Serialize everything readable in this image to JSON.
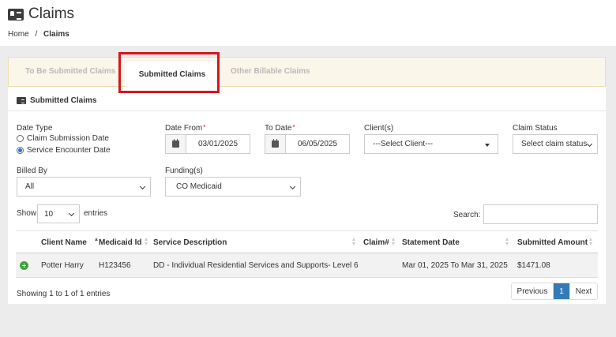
{
  "header": {
    "title": "Claims",
    "breadcrumb": {
      "home": "Home",
      "separator": "/",
      "current": "Claims"
    }
  },
  "tabs": [
    {
      "label": "To Be Submitted Claims",
      "active": false
    },
    {
      "label": "Submitted Claims",
      "active": true
    },
    {
      "label": "Other Billable Claims",
      "active": false
    }
  ],
  "section": {
    "title": "Submitted Claims"
  },
  "filters": {
    "date_type": {
      "label": "Date Type",
      "options": [
        {
          "label": "Claim Submission Date",
          "checked": false
        },
        {
          "label": "Service Encounter Date",
          "checked": true
        }
      ]
    },
    "date_from": {
      "label": "Date From",
      "required_mark": "*",
      "value": "03/01/2025"
    },
    "to_date": {
      "label": "To Date",
      "required_mark": "*",
      "value": "06/05/2025"
    },
    "clients": {
      "label": "Client(s)",
      "value": "---Select Client---"
    },
    "claim_status": {
      "label": "Claim Status",
      "value": "Select claim status"
    },
    "billed_by": {
      "label": "Billed By",
      "value": "All"
    },
    "funding": {
      "label": "Funding(s)",
      "value": "CO Medicaid"
    }
  },
  "table_controls": {
    "show_label": "Show",
    "entries_value": "10",
    "entries_label": "entries",
    "search_label": "Search:",
    "search_value": ""
  },
  "table": {
    "columns": [
      "Client Name",
      "Medicaid Id",
      "Service Description",
      "Claim#",
      "Statement Date",
      "Submitted Amount"
    ],
    "rows": [
      [
        "Potter Harry",
        "H123456",
        "DD - Individual Residential Services and Supports- Level 6",
        "",
        "Mar 01, 2025 To Mar 31, 2025",
        "$1471.08"
      ]
    ]
  },
  "footer": {
    "info": "Showing 1 to 1 of 1 entries",
    "pagination": {
      "previous": "Previous",
      "current_page": "1",
      "next": "Next"
    }
  },
  "colors": {
    "highlight": "#d4161c",
    "accent": "#337ab7",
    "expand": "#3fa33c",
    "required": "#dd0000"
  }
}
